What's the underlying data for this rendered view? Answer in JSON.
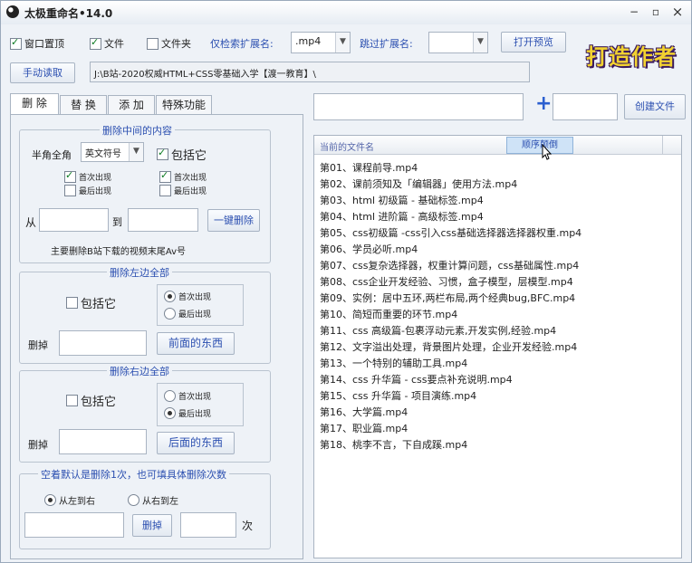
{
  "window": {
    "title": "太极重命名•14.0",
    "min": "−",
    "max": "▫",
    "close": "×"
  },
  "top": {
    "chk_window_top": "窗口置顶",
    "chk_file": "文件",
    "chk_folder": "文件夹",
    "only_ext_label": "仅检索扩展名:",
    "only_ext_value": ".mp4",
    "skip_ext_label": "跳过扩展名:",
    "skip_ext_value": "",
    "open_preview": "打开预览",
    "manual_read": "手动读取",
    "path": "J:\\B站-2020权威HTML+CSS零基础入学【渡一教育】\\",
    "logo": "打造作者"
  },
  "tabs": [
    "删 除",
    "替 换",
    "添 加",
    "特殊功能"
  ],
  "middle": {
    "section_title": "删除中间的内容",
    "halfwidth_label": "半角全角",
    "symbol_type": "英文符号",
    "include_it": "包括它",
    "first_occur": "首次出现",
    "last_occur": "最后出现",
    "from": "从",
    "to": "到",
    "one_key_delete": "一键删除",
    "hint": "主要删除B站下载的视频末尾Av号"
  },
  "left_all": {
    "section_title": "删除左边全部",
    "include_it": "包括它",
    "first_occur": "首次出现",
    "last_occur": "最后出现",
    "delete_label": "删掉",
    "front_stuff": "前面的东西"
  },
  "right_all": {
    "section_title": "删除右边全部",
    "include_it": "包括它",
    "first_occur": "首次出现",
    "last_occur": "最后出现",
    "delete_label": "删掉",
    "back_stuff": "后面的东西"
  },
  "count": {
    "section_title": "空着默认是删除1次，也可填具体删除次数",
    "ltr": "从左到右",
    "rtl": "从右到左",
    "delete": "删掉",
    "times": "次"
  },
  "right_panel": {
    "plus": "+",
    "create_file": "创建文件",
    "list_header": "当前的文件名",
    "sort_reverse": "顺序颠倒",
    "files": [
      "第01、课程前导.mp4",
      "第02、课前须知及「编辑器」使用方法.mp4",
      "第03、html 初级篇 - 基础标签.mp4",
      "第04、html 进阶篇 - 高级标签.mp4",
      "第05、css初级篇 -css引入css基础选择器选择器权重.mp4",
      "第06、学员必听.mp4",
      "第07、css复杂选择器，权重计算问题，css基础属性.mp4",
      "第08、css企业开发经验、习惯，盒子模型，层模型.mp4",
      "第09、实例：居中五环,两栏布局,两个经典bug,BFC.mp4",
      "第10、简短而重要的环节.mp4",
      "第11、css 高级篇-包裹浮动元素,开发实例,经验.mp4",
      "第12、文字溢出处理，背景图片处理，企业开发经验.mp4",
      "第13、一个特别的辅助工具.mp4",
      "第14、css 升华篇 - css要点补充说明.mp4",
      "第15、css 升华篇 - 项目演练.mp4",
      "第16、大学篇.mp4",
      "第17、职业篇.mp4",
      "第18、桃李不言，下自成蹊.mp4"
    ]
  }
}
